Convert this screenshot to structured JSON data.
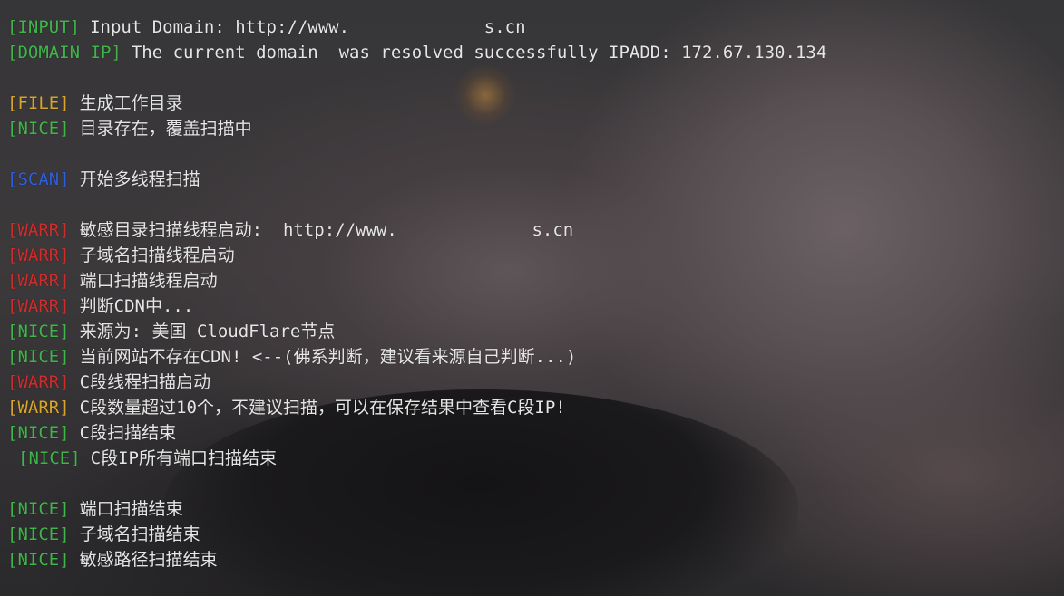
{
  "window": {
    "background_colors": {
      "primary": "#2b2a2c",
      "skin": "#6b6164"
    }
  },
  "tag_colors": {
    "green": "#3fb54a",
    "blue": "#2e5fe0",
    "yellow": "#d9a52a",
    "red": "#d02c2c",
    "text": "#e6e6e6"
  },
  "terminal": {
    "lines": [
      {
        "tag": "[INPUT]",
        "tag_color": "green",
        "text": "Input Domain: http://www.             s.cn",
        "blank": false
      },
      {
        "tag": "[DOMAIN IP]",
        "tag_color": "green",
        "text": "The current domain  was resolved successfully IPADD: 172.67.130.134",
        "blank": false
      },
      {
        "blank": true
      },
      {
        "tag": "[FILE]",
        "tag_color": "yellow",
        "text": "生成工作目录",
        "blank": false
      },
      {
        "tag": "[NICE]",
        "tag_color": "green",
        "text": "目录存在，覆盖扫描中",
        "blank": false
      },
      {
        "blank": true
      },
      {
        "tag": "[SCAN]",
        "tag_color": "blue",
        "text": "开始多线程扫描",
        "blank": false
      },
      {
        "blank": true
      },
      {
        "tag": "[WARR]",
        "tag_color": "red",
        "text": "敏感目录扫描线程启动:  http://www.             s.cn",
        "blank": false
      },
      {
        "tag": "[WARR]",
        "tag_color": "red",
        "text": "子域名扫描线程启动",
        "blank": false
      },
      {
        "tag": "[WARR]",
        "tag_color": "red",
        "text": "端口扫描线程启动",
        "blank": false
      },
      {
        "tag": "[WARR]",
        "tag_color": "red",
        "text": "判断CDN中...",
        "blank": false
      },
      {
        "tag": "[NICE]",
        "tag_color": "green",
        "text": "来源为: 美国 CloudFlare节点",
        "blank": false
      },
      {
        "tag": "[NICE]",
        "tag_color": "green",
        "text": "当前网站不存在CDN! <--(佛系判断，建议看来源自己判断...)",
        "blank": false
      },
      {
        "tag": "[WARR]",
        "tag_color": "red",
        "text": "C段线程扫描启动",
        "blank": false
      },
      {
        "tag": "[WARR]",
        "tag_color": "yellow",
        "text": "C段数量超过10个，不建议扫描，可以在保存结果中查看C段IP!",
        "blank": false
      },
      {
        "tag": "[NICE]",
        "tag_color": "green",
        "text": "C段扫描结束",
        "blank": false
      },
      {
        "tag": "[NICE]",
        "tag_color": "green",
        "text": "C段IP所有端口扫描结束",
        "blank": false,
        "indent": true
      },
      {
        "blank": true
      },
      {
        "tag": "[NICE]",
        "tag_color": "green",
        "text": "端口扫描结束",
        "blank": false
      },
      {
        "tag": "[NICE]",
        "tag_color": "green",
        "text": "子域名扫描结束",
        "blank": false
      },
      {
        "tag": "[NICE]",
        "tag_color": "green",
        "text": "敏感路径扫描结束",
        "blank": false
      }
    ]
  }
}
